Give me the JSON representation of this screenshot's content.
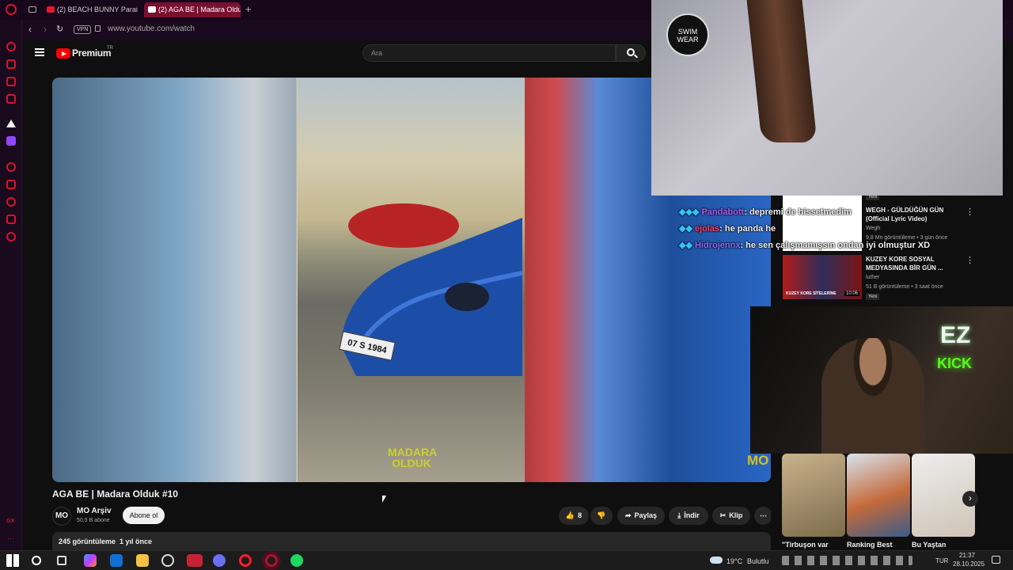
{
  "tabs": [
    {
      "label": "(2) BEACH BUNNY Parais"
    },
    {
      "label": "(2) AGA BE | Madara Oldu"
    }
  ],
  "address": {
    "vpn": "VPN",
    "url": "www.youtube.com/watch"
  },
  "yt": {
    "logo": "Premium",
    "region": "TR",
    "search_placeholder": "Ara"
  },
  "video": {
    "title": "AGA BE | Madara Olduk #10",
    "overlay_text_line1": "MADARA",
    "overlay_text_line2": "OLDUK",
    "plate": "07 S 1984",
    "watermark": "MO",
    "channel_name": "MO Arşiv",
    "subscribers": "50,5 B abone",
    "subscribe_label": "Abone ol",
    "likes": "8",
    "share_label": "Paylaş",
    "download_label": "İndir",
    "clip_label": "Klip",
    "views": "245 görüntüleme",
    "age": "1 yıl önce"
  },
  "overlay": {
    "swimwear_logo": "SWIM WEAR"
  },
  "chat": [
    {
      "user": "Pandabott",
      "message": ": depremi de hissetmedim",
      "color": "#b05cff"
    },
    {
      "user": "ejolas",
      "message": ": he panda he",
      "color": "#ff3d6b"
    },
    {
      "user": "Hidrojennx",
      "message": ": he sen çalışmamışsın ondan iyi olmuştur XD",
      "color": "#8a6bff"
    }
  ],
  "sidebar_videos": [
    {
      "badge": "Yeni",
      "title": "WEGH - GÜLDÜĞÜN GÜN (Official Lyric Video)",
      "channel": "Wegh",
      "meta": "9,8 Mn görüntüleme • 3 gün önce"
    },
    {
      "title": "KUZEY KORE SOSYAL MEDYASINDA BİR GÜN ...",
      "channel": "luther",
      "meta": "51 B görüntüleme • 3 saat önce",
      "duration": "10:06",
      "badge": "Yeni",
      "thumb_text": "KUZEY KORE SİTELERİNE"
    }
  ],
  "webcam": {
    "logo_top": "EZ",
    "logo_bottom": "KICK"
  },
  "shorts": [
    {
      "title": "\"Tirbuşon var"
    },
    {
      "title": "Ranking Best"
    },
    {
      "title": "Bu Yaştan"
    }
  ],
  "taskbar": {
    "weather": "19°C",
    "weather_desc": "Bulutlu",
    "lang": "TUR",
    "time": "21:37",
    "date": "28.10.2025"
  },
  "colors": {
    "accent": "#e21b2d",
    "yt_red": "#ff0000",
    "kick": "#53fc18"
  }
}
